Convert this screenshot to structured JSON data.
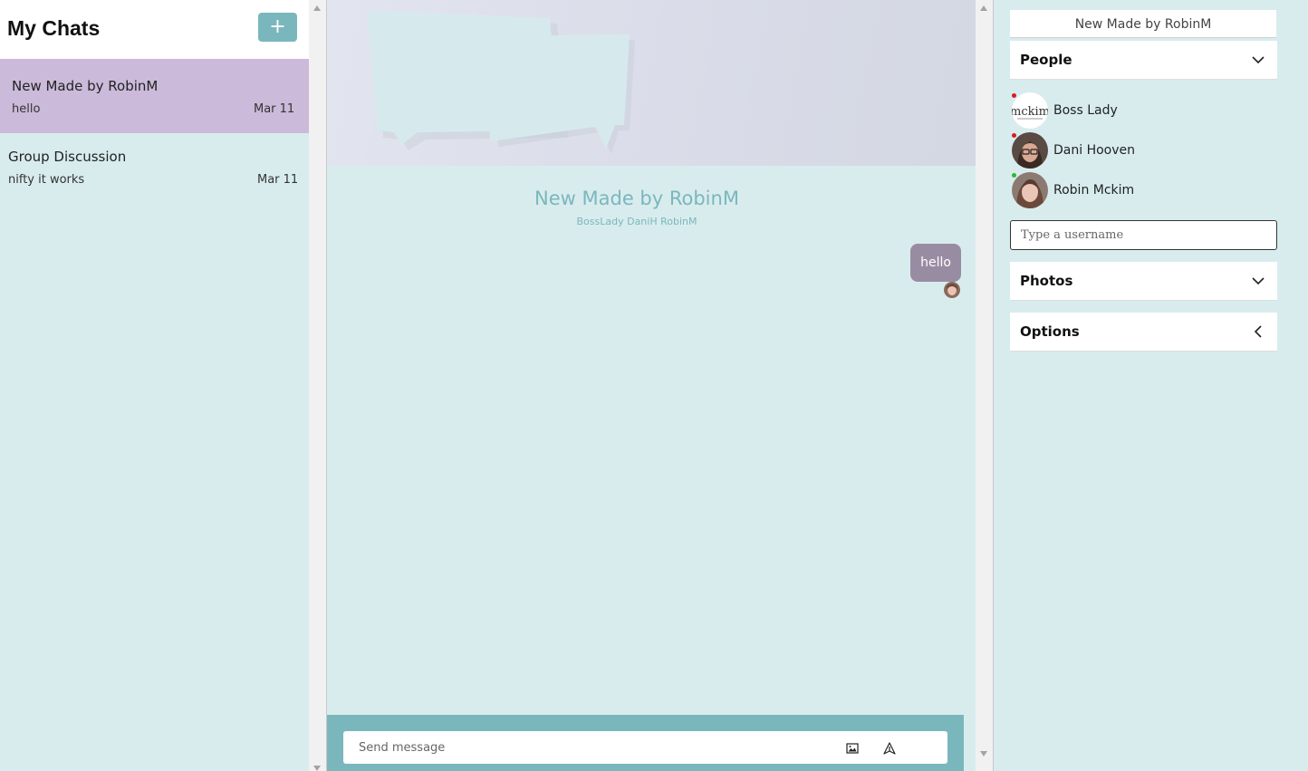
{
  "left": {
    "title": "My Chats",
    "new_chat_label": "+",
    "chats": [
      {
        "name": "New Made by RobinM",
        "last_message": "hello",
        "date": "Mar 11",
        "active": true
      },
      {
        "name": "Group Discussion",
        "last_message": "nifty it works",
        "date": "Mar 11",
        "active": false
      }
    ]
  },
  "chat": {
    "title": "New Made by RobinM",
    "members": "BossLady DaniH RobinM",
    "messages": [
      {
        "text": "hello",
        "from_me": true
      }
    ],
    "composer": {
      "placeholder": "Send message",
      "photo_icon": "image-icon",
      "send_icon": "send-icon"
    }
  },
  "settings": {
    "title": "New Made by RobinM",
    "people_label": "People",
    "people": [
      {
        "name": "Boss Lady",
        "status": "offline",
        "avatar": "mckim-logo"
      },
      {
        "name": "Dani Hooven",
        "status": "offline",
        "avatar": "photo"
      },
      {
        "name": "Robin Mckim",
        "status": "online",
        "avatar": "photo"
      }
    ],
    "username_placeholder": "Type a username",
    "photos_label": "Photos",
    "options_label": "Options"
  },
  "colors": {
    "accent": "#7ab7bd",
    "background": "#d8ecee",
    "active_chat": "#cbbada",
    "bubble": "#988ca2",
    "online": "#2fb82f",
    "offline": "#d81c1c"
  }
}
